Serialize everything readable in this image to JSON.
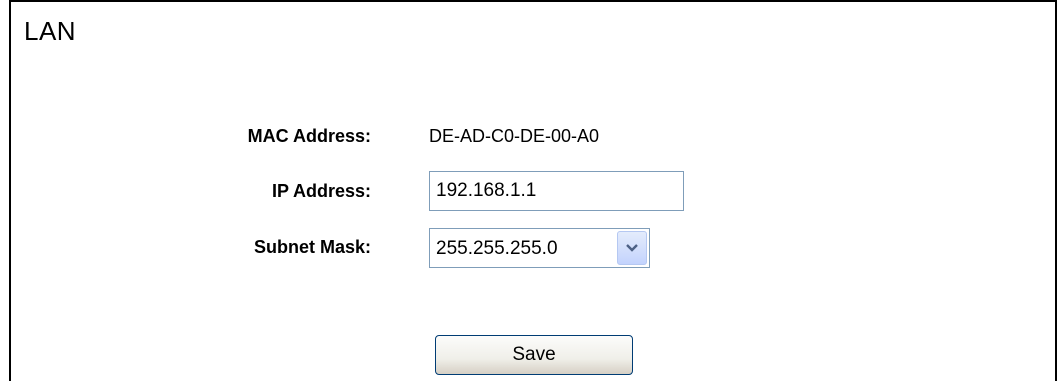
{
  "section": {
    "title": "LAN"
  },
  "fields": {
    "mac": {
      "label": "MAC Address:",
      "value": "DE-AD-C0-DE-00-A0"
    },
    "ip": {
      "label": "IP Address:",
      "value": "192.168.1.1"
    },
    "subnet": {
      "label": "Subnet Mask:",
      "value": "255.255.255.0",
      "options": [
        "255.255.255.0"
      ]
    }
  },
  "actions": {
    "save_label": "Save"
  },
  "icons": {
    "dropdown": "chevron-down-icon"
  },
  "colors": {
    "input_border": "#7f9db9",
    "button_border": "#003c74",
    "dropdown_arrow": "#4d6185"
  }
}
